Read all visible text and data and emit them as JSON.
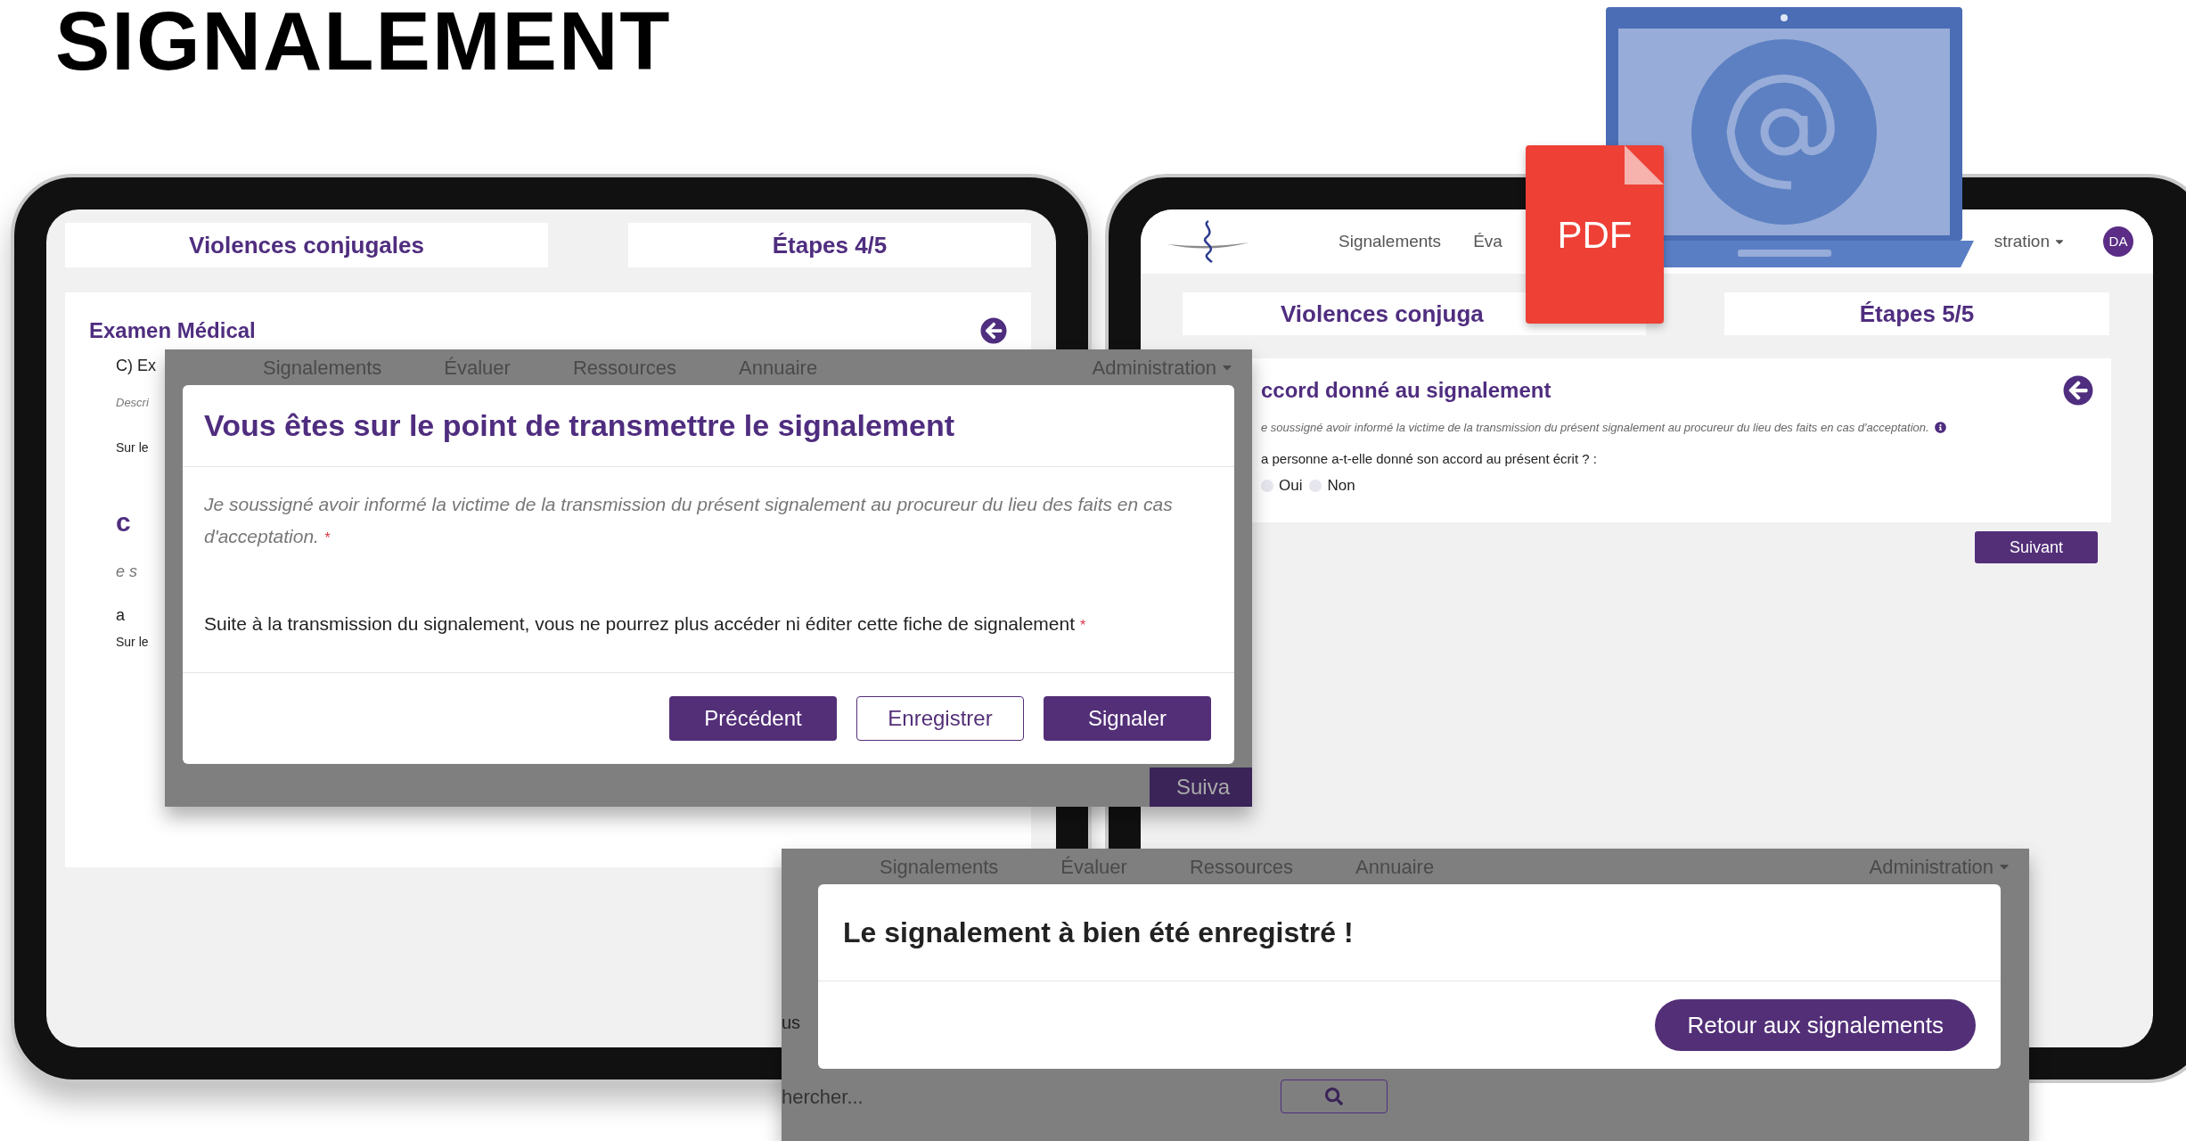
{
  "page_title": "SIGNALEMENT",
  "left_tablet": {
    "header_cards": [
      "Violences conjugales",
      "Étapes 4/5"
    ],
    "section_title": "Examen Médical",
    "fragments": [
      {
        "text": "C) Ex",
        "kind": "label"
      },
      {
        "text": "Descri",
        "kind": "hint"
      },
      {
        "text": "Sur le",
        "kind": "small"
      },
      {
        "text": "c",
        "kind": "heading"
      },
      {
        "text": "e s",
        "kind": "italic"
      },
      {
        "text": "a",
        "kind": "label"
      },
      {
        "text": "Sur le",
        "kind": "small"
      }
    ]
  },
  "transmit_dialog": {
    "background_nav": [
      "Signalements",
      "Évaluer",
      "Ressources",
      "Annuaire",
      "Administration"
    ],
    "title": "Vous êtes sur le point de transmettre le signalement",
    "statements": [
      {
        "text": "Je soussigné avoir informé la victime de la transmission du présent signalement au procureur du lieu des faits en cas d'acceptation.",
        "italic": true,
        "mark": "*"
      },
      {
        "text": "Suite à la transmission du signalement, vous ne pourrez plus accéder ni éditer cette fiche de signalement",
        "italic": false,
        "mark": "*"
      }
    ],
    "buttons": [
      {
        "label": "Précédent",
        "kind": "primary"
      },
      {
        "label": "Enregistrer",
        "kind": "outline"
      },
      {
        "label": "Signaler",
        "kind": "primary"
      }
    ],
    "background_button": "Suiva"
  },
  "right_tablet": {
    "nav": [
      "Signalements",
      "Éva",
      "stration"
    ],
    "avatar": "DA",
    "header_cards": [
      "Violences conjuga",
      "Étapes 5/5"
    ],
    "section_title": "ccord donné au signalement",
    "note": "e soussigné avoir informé la victime de la transmission du présent signalement au procureur du lieu des faits en cas d'acceptation.",
    "question": "a personne a-t-elle donné son accord au présent écrit ? :",
    "options": [
      {
        "label": "Oui",
        "selected": false
      },
      {
        "label": "Non",
        "selected": false
      }
    ],
    "next_button": "Suivant"
  },
  "pdf_icon_label": "PDF",
  "saved_dialog": {
    "background_nav": [
      "Signalements",
      "Évaluer",
      "Ressources",
      "Annuaire",
      "Administration"
    ],
    "background_label": "us",
    "background_search_placeholder": "hercher...",
    "title": "Le signalement à bien été enregistré !",
    "button": "Retour aux signalements"
  }
}
